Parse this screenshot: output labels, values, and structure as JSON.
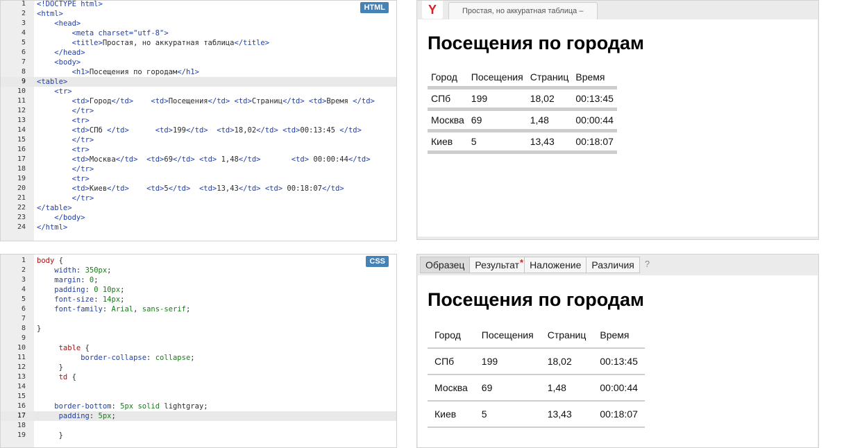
{
  "html_panel": {
    "badge": "HTML",
    "lines": [
      "<!DOCTYPE html>",
      "<html>",
      "    <head>",
      "        <meta charset=\"utf-8\">",
      "        <title>Простая, но аккуратная таблица</title>",
      "    </head>",
      "    <body>",
      "        <h1>Посещения по городам</h1>",
      "<table>",
      "    <tr>",
      "        <td>Город</td>    <td>Посещения</td> <td>Страниц</td> <td>Время </td>",
      "        </tr>",
      "        <tr>",
      "        <td>СПб </td>      <td>199</td>  <td>18,02</td> <td>00:13:45 </td>",
      "        </tr>",
      "        <tr>",
      "        <td>Москва</td>  <td>69</td> <td> 1,48</td>       <td> 00:00:44</td>",
      "        </tr>",
      "        <tr>",
      "        <td>Киев</td>    <td>5</td>  <td>13,43</td> <td> 00:18:07</td>",
      "        </tr>",
      "</table>",
      "    </body>",
      "</html>"
    ]
  },
  "css_panel": {
    "badge": "CSS",
    "lines": [
      "body {",
      "    width: 350px;",
      "    margin: 0;",
      "    padding: 0 10px;",
      "    font-size: 14px;",
      "    font-family: Arial, sans-serif;",
      "",
      "}",
      "",
      "     table {",
      "          border-collapse: collapse;",
      "     }",
      "     td {",
      "",
      "",
      "    border-bottom: 5px solid lightgray;",
      "     padding: 5px;",
      "",
      "     }"
    ]
  },
  "preview_panel": {
    "browser_icon": "Y",
    "tab_title": "Простая, но аккуратная таблица –",
    "heading": "Посещения по городам",
    "table": [
      [
        "Город",
        "Посещения",
        "Страниц",
        "Время"
      ],
      [
        "СПб",
        "199",
        "18,02",
        "00:13:45"
      ],
      [
        "Москва",
        "69",
        "1,48",
        "00:00:44"
      ],
      [
        "Киев",
        "5",
        "13,43",
        "00:18:07"
      ]
    ]
  },
  "result_panel": {
    "tabs": [
      "Образец",
      "Результат",
      "Наложение",
      "Различия"
    ],
    "help": "?",
    "result_marker": "*",
    "heading": "Посещения по городам",
    "table": [
      [
        "Город",
        "Посещения",
        "Страниц",
        "Время"
      ],
      [
        "СПб",
        "199",
        "18,02",
        "00:13:45"
      ],
      [
        "Москва",
        "69",
        "1,48",
        "00:00:44"
      ],
      [
        "Киев",
        "5",
        "13,43",
        "00:18:07"
      ]
    ]
  }
}
